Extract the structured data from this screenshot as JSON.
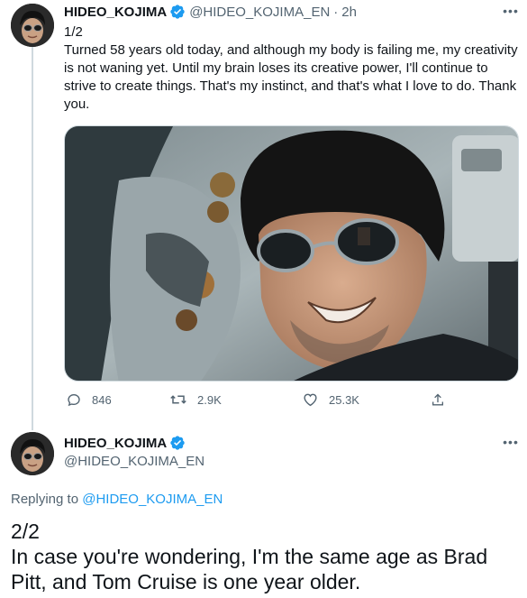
{
  "tweet1": {
    "display_name": "HIDEO_KOJIMA",
    "handle": "@HIDEO_KOJIMA_EN",
    "separator": "·",
    "time": "2h",
    "more_label": "•••",
    "text": "1/2\nTurned 58 years old today, and although my body is failing me, my creativity is not waning yet. Until my brain loses its creative power, I'll continue to strive to create things. That's my instinct, and that's what I love to do. Thank you.",
    "actions": {
      "reply_count": "846",
      "retweet_count": "2.9K",
      "like_count": "25.3K"
    }
  },
  "tweet2": {
    "display_name": "HIDEO_KOJIMA",
    "handle": "@HIDEO_KOJIMA_EN",
    "more_label": "•••",
    "replying_prefix": "Replying to ",
    "replying_handle": "@HIDEO_KOJIMA_EN",
    "text": "2/2\nIn case you're wondering, I'm the same age as Brad Pitt, and Tom Cruise is one year older."
  },
  "colors": {
    "verified": "#1d9bf0",
    "link": "#1d9bf0",
    "muted": "#536471",
    "text": "#0f1419"
  }
}
